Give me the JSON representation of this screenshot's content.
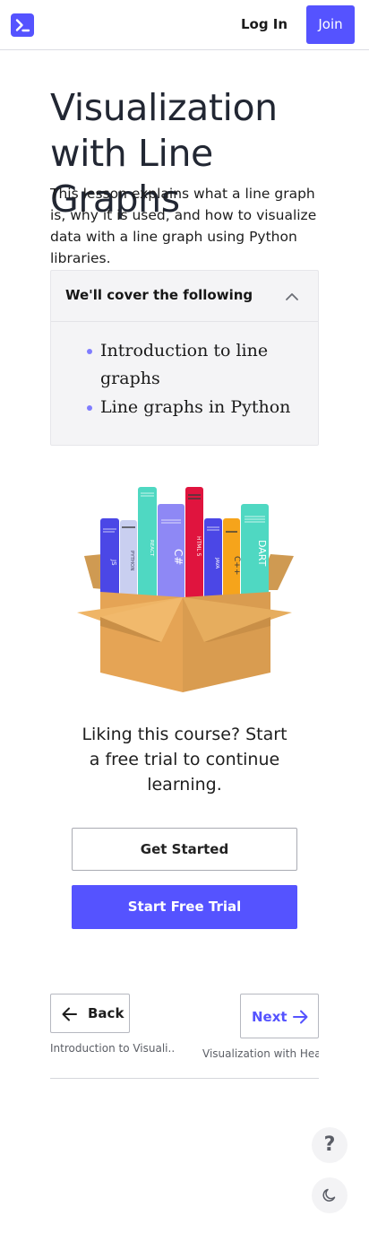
{
  "header": {
    "logo_icon": "terminal-icon",
    "login_label": "Log In",
    "join_label": "Join",
    "accent_color": "#5553ff"
  },
  "lesson": {
    "title": "Visualization with Line Graphs",
    "description": "This lesson explains what a line graph is, why it is used, and how to visualize data with a line graph using Python libraries."
  },
  "coverage": {
    "heading": "We'll cover the following",
    "chevron_icon": "chevron-up-icon",
    "items": [
      "Introduction to line graphs",
      "Line graphs in Python"
    ]
  },
  "illustration": {
    "name": "books-in-box-illustration",
    "book_labels": [
      "JS",
      "PYTHON",
      "REACT",
      "C#",
      "HTML 5",
      "JAVA",
      "C++",
      "DART"
    ]
  },
  "promo": {
    "text": "Liking this course? Start a free trial to continue learning.",
    "get_started_label": "Get Started",
    "free_trial_label": "Start Free Trial"
  },
  "navigation": {
    "back_label": "Back",
    "back_subtitle": "Introduction to Visuali...",
    "next_label": "Next",
    "next_subtitle": "Visualization with Hea..."
  },
  "floating": {
    "help_glyph": "?",
    "help_icon": "question-icon",
    "theme_icon": "moon-icon"
  }
}
